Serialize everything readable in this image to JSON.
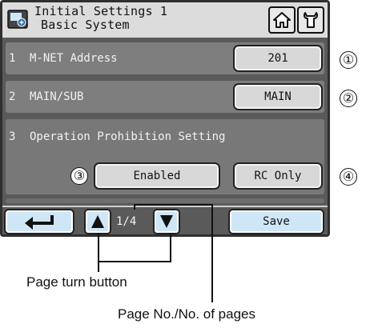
{
  "header": {
    "title_line1": "Initial Settings 1",
    "title_line2": "Basic System",
    "icons": [
      "screen-icon",
      "home-icon",
      "wrench-icon"
    ]
  },
  "rows": [
    {
      "number": "1",
      "label": "M-NET Address",
      "value": "201"
    },
    {
      "number": "2",
      "label": "MAIN/SUB",
      "value": "MAIN"
    },
    {
      "number": "3",
      "label": "Operation Prohibition Setting",
      "values": [
        "Enabled",
        "RC Only"
      ]
    }
  ],
  "footer": {
    "back_icon": "return-arrow-icon",
    "page_indicator": "1/4",
    "save_label": "Save"
  },
  "callouts": [
    "①",
    "②",
    "③",
    "④"
  ],
  "annotations": {
    "page_turn": "Page turn button",
    "page_number": "Page No./No. of pages"
  },
  "colors": {
    "device_bezel": "#2f2f2f",
    "screen_bg": "#5a5a5a",
    "header_bg": "#dcdcdc",
    "row_bg": "#7e7e7e",
    "value_button": "#d8d8d8",
    "nav_button": "#cfe6f7"
  }
}
